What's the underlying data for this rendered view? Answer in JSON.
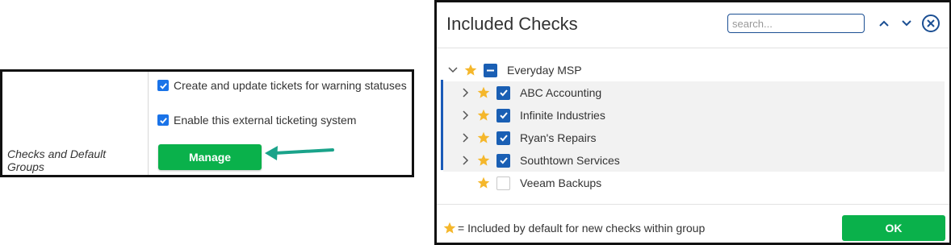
{
  "settings": {
    "options": [
      {
        "label": "Create and update tickets for warning statuses",
        "checked": true
      },
      {
        "label": "Enable this external ticketing system",
        "checked": true
      }
    ],
    "group_label": "Checks and Default Groups",
    "manage_label": "Manage"
  },
  "dialog": {
    "title": "Included Checks",
    "search_placeholder": "search...",
    "tree": {
      "root": {
        "label": "Everyday MSP",
        "state": "partial",
        "starred": true,
        "expanded": true
      },
      "children": [
        {
          "label": "ABC Accounting",
          "state": "checked",
          "starred": true,
          "expandable": true
        },
        {
          "label": "Infinite Industries",
          "state": "checked",
          "starred": true,
          "expandable": true
        },
        {
          "label": "Ryan's Repairs",
          "state": "checked",
          "starred": true,
          "expandable": true
        },
        {
          "label": "Southtown Services",
          "state": "checked",
          "starred": true,
          "expandable": true
        },
        {
          "label": "Veeam Backups",
          "state": "unchecked",
          "starred": true,
          "expandable": false
        }
      ]
    },
    "legend_text": "= Included by default for new checks within group",
    "ok_label": "OK"
  },
  "colors": {
    "accent_green": "#0ab14b",
    "accent_blue": "#1a5fb4",
    "star": "#f5b72b",
    "arrow": "#1aa38a"
  },
  "icons": [
    "checkbox-checked-icon",
    "arrow-icon",
    "chevron-up-icon",
    "chevron-down-icon",
    "close-circle-icon",
    "chevron-right-icon",
    "star-icon"
  ]
}
